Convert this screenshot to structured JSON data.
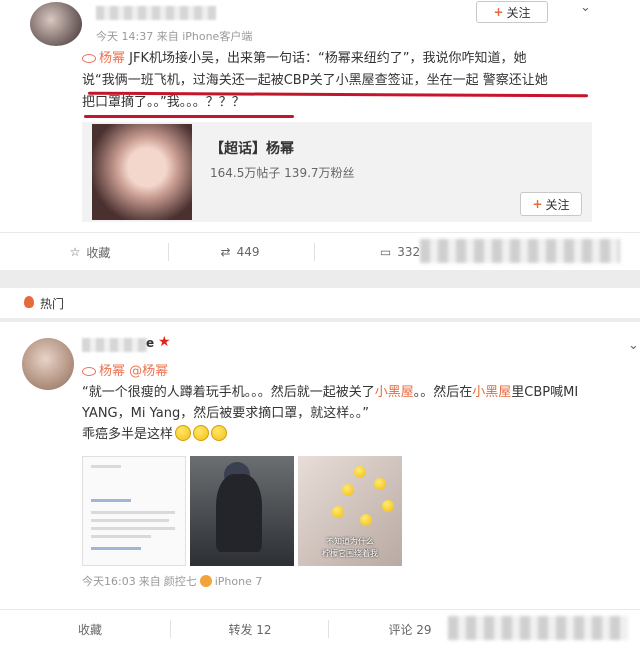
{
  "post1": {
    "meta_time": "今天 14:37",
    "meta_from": "来自 iPhone客户端",
    "follow_label": "关注",
    "mention_name": "杨幂",
    "line1_rest": " JFK机场接小吴，出来第一句话：“杨幂来纽约了”，我说你咋知道，她",
    "line2": "说“我俩一班飞机，过海关还一起被CBP关了小黑屋查签证，坐在一起 警察还让她",
    "line3": "把口罩摘了。。”我。。。？？？",
    "topic": {
      "title": "【超话】杨幂",
      "stats": "164.5万帖子 139.7万粉丝",
      "follow_label": "关注"
    },
    "actions": {
      "favorite": "收藏",
      "share_count": "449",
      "comment_count": "332"
    }
  },
  "hot_label": "热门",
  "post2": {
    "name_tail": "e",
    "mention1": "杨幂",
    "mention2": "@杨幂",
    "text_a": "“就一个很瘦的人蹲着玩手机。。。然后就一起被关了",
    "hl1": "小黑屋",
    "text_b": "。。然后在",
    "hl2": "小黑屋",
    "text_c": "里CBP喊MI YANG，Mi Yang，然后被要求摘口罩，就这样。。”",
    "text_d": "乖癌多半是这样",
    "image3_caption_1": "不知道为什么",
    "image3_caption_2": "柠檬它围绕着我",
    "meta_time": "今天16:03",
    "meta_from": "来自",
    "meta_device1": "颜控七",
    "meta_device2": "iPhone 7",
    "actions": {
      "favorite": "收藏",
      "repost": "转发 12",
      "comment": "评论 29"
    }
  },
  "colors": {
    "accent": "#eb7350",
    "underline": "#c4162a",
    "vip_star": "#e2231a"
  }
}
